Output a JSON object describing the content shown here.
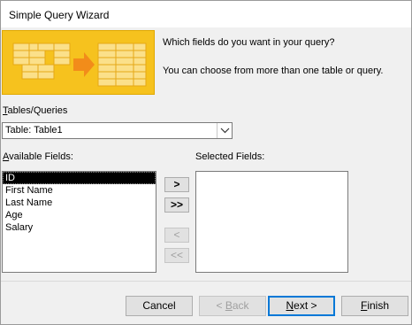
{
  "window": {
    "title": "Simple Query Wizard"
  },
  "intro": {
    "line1": "Which fields do you want in your query?",
    "line2": "You can choose from more than one table or query."
  },
  "tables_queries": {
    "label_first": "T",
    "label_rest": "ables/Queries",
    "selected_value": "Table: Table1",
    "dropdown_icon": "chevron-down-icon"
  },
  "available_fields": {
    "label_first": "A",
    "label_rest": "vailable Fields:",
    "items": [
      "ID",
      "First Name",
      "Last Name",
      "Age",
      "Salary"
    ],
    "selected_index": 0
  },
  "selected_fields": {
    "label": "Selected Fields:",
    "items": []
  },
  "move_buttons": {
    "add_one": ">",
    "add_all": ">>",
    "remove_one": "<",
    "remove_all": "<<"
  },
  "footer": {
    "cancel": "Cancel",
    "back_pre": "< ",
    "back_u": "B",
    "back_rest": "ack",
    "next_u": "N",
    "next_rest": "ext >",
    "finish_u": "F",
    "finish_rest": "inish"
  },
  "colors": {
    "banner": "#f6c21e",
    "selection": "#000000",
    "default_button_border": "#0078d7"
  }
}
